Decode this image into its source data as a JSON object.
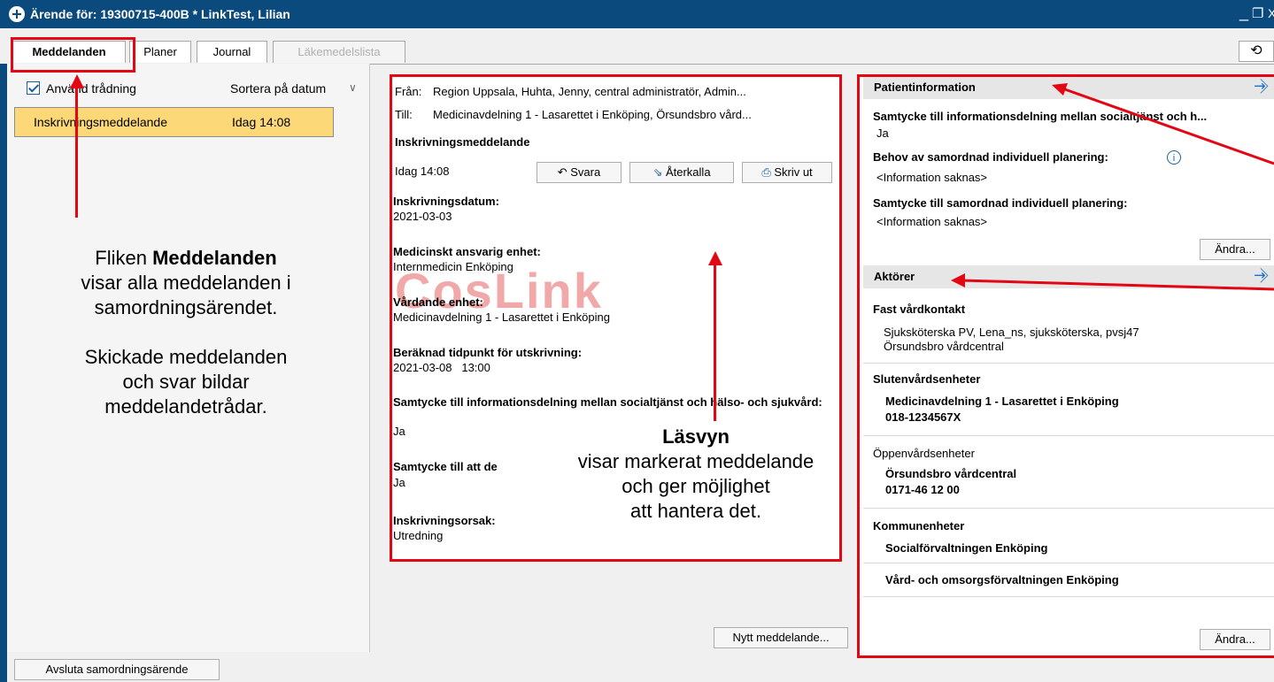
{
  "window": {
    "title": "Ärende för: 19300715-400B * LinkTest, Lilian",
    "min_glyph": "_",
    "restore_glyph": "❐",
    "close_glyph": "X"
  },
  "tabs": [
    {
      "label": "Meddelanden"
    },
    {
      "label": "Planer"
    },
    {
      "label": "Journal"
    },
    {
      "label": "Läkemedelslista"
    }
  ],
  "history_glyph": "⟲",
  "left": {
    "threading_label": "Använd trådning",
    "sort_label": "Sortera på datum",
    "sort_chevron": "∨",
    "message": {
      "title": "Inskrivningsmeddelande",
      "time": "Idag 14:08"
    }
  },
  "annotations": {
    "tab_note_line1": "Fliken",
    "tab_note_bold": "Meddelanden",
    "tab_note_line2": "visar alla meddelanden i",
    "tab_note_line3": "samordningsärendet.",
    "tab_note_line4": "Skickade meddelanden",
    "tab_note_line5": "och svar bildar",
    "tab_note_line6": "meddelandetrådar.",
    "read_title": "Läsvyn",
    "read_line1": "visar markerat meddelande",
    "read_line2": "och ger möjlighet",
    "read_line3": "att hantera det."
  },
  "reading": {
    "from_label": "Från:",
    "from_value": "Region Uppsala, Huhta, Jenny, central administratör, Admin...",
    "to_label": "Till:",
    "to_value": "Medicinavdelning 1 - Lasarettet i Enköping, Örsundsbro vård...",
    "subject": "Inskrivningsmeddelande",
    "time": "Idag 14:08",
    "reply_label": "Svara",
    "recall_label": "Återkalla",
    "print_label": "Skriv ut",
    "fields": [
      {
        "label": "Inskrivningsdatum:",
        "value": "2021-03-03"
      },
      {
        "label": "Medicinskt ansvarig enhet:",
        "value": "Internmedicin Enköping"
      },
      {
        "label": "Vårdande enhet:",
        "value": "Medicinavdelning 1 - Lasarettet i Enköping"
      },
      {
        "label": "Beräknad tidpunkt för utskrivning:",
        "value": "2021-03-08   13:00"
      },
      {
        "label": "Samtycke till informationsdelning mellan socialtjänst och hälso- och sjukvård:",
        "value": "Ja"
      },
      {
        "label": "Samtycke till att de",
        "value": "Ja"
      },
      {
        "label": "Inskrivningsorsak:",
        "value": "Utredning"
      }
    ],
    "watermark": "CosLink",
    "new_message_label": "Nytt meddelande..."
  },
  "patient_info": {
    "header": "Patientinformation",
    "consent_label": "Samtycke till informationsdelning mellan socialtjänst och h...",
    "consent_value": "Ja",
    "need_label": "Behov av samordnad individuell planering:",
    "need_value": "<Information saknas>",
    "plan_label": "Samtycke till samordnad individuell planering:",
    "plan_value": "<Information saknas>",
    "edit_label": "Ändra..."
  },
  "actors": {
    "header": "Aktörer",
    "fast_label": "Fast vårdkontakt",
    "fast_line1": "Sjuksköterska PV, Lena_ns, sjuksköterska, pvsj47",
    "fast_line2": "Örsundsbro vårdcentral",
    "sluten_label": "Slutenvårdsenheter",
    "sluten_name": "Medicinavdelning 1 - Lasarettet i Enköping",
    "sluten_phone": "018-1234567X",
    "oppen_label": "Öppenvårdsenheter",
    "oppen_name": "Örsundsbro vårdcentral",
    "oppen_phone": "0171-46 12 00",
    "kommun_label": "Kommunenheter",
    "kommun1": "Socialförvaltningen Enköping",
    "kommun2": "Vård- och omsorgsförvaltningen Enköping",
    "edit_label": "Ändra..."
  },
  "footer": {
    "close_case_label": "Avsluta samordningsärende"
  },
  "colors": {
    "accent_red": "#e30613",
    "title_blue": "#0b4a7c",
    "selected_row": "#fcd878"
  }
}
